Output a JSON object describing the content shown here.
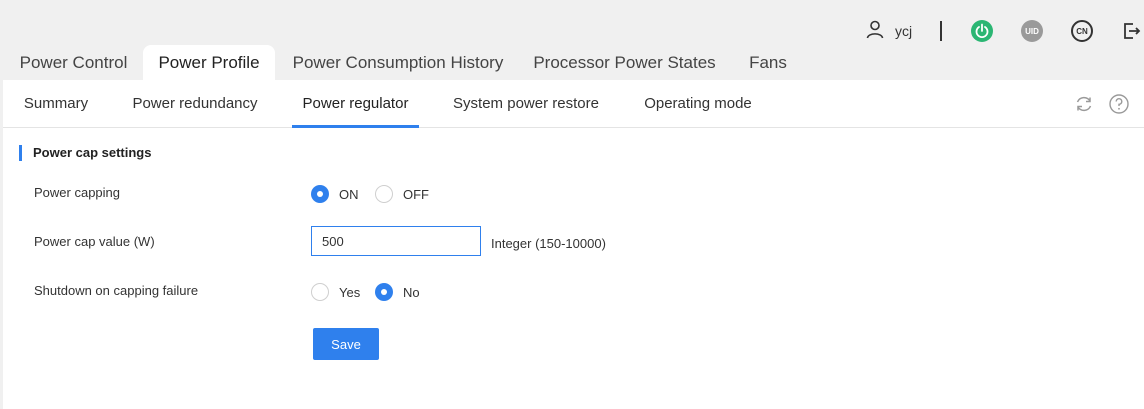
{
  "header": {
    "username": "ycj",
    "icons": {
      "user": "user-icon",
      "power": "power-icon",
      "uid": "UID",
      "language": "CN",
      "logout": "logout-icon"
    },
    "colors": {
      "power": "#2bb673",
      "uid": "#9a9a9a"
    }
  },
  "main_tabs": [
    {
      "label": "Power Control",
      "active": false
    },
    {
      "label": "Power Profile",
      "active": true
    },
    {
      "label": "Power Consumption History",
      "active": false
    },
    {
      "label": "Processor Power States",
      "active": false
    },
    {
      "label": "Fans",
      "active": false
    }
  ],
  "sub_tabs": [
    {
      "label": "Summary",
      "active": false
    },
    {
      "label": "Power redundancy",
      "active": false
    },
    {
      "label": "Power regulator",
      "active": true
    },
    {
      "label": "System power restore",
      "active": false
    },
    {
      "label": "Operating mode",
      "active": false
    }
  ],
  "section": {
    "title": "Power cap settings"
  },
  "form": {
    "power_capping": {
      "label": "Power capping",
      "options": [
        "ON",
        "OFF"
      ],
      "selected": "ON"
    },
    "power_cap_value": {
      "label": "Power cap value (W)",
      "value": "500",
      "hint": "Integer (150-10000)"
    },
    "shutdown_on_failure": {
      "label": "Shutdown on capping failure",
      "options": [
        "Yes",
        "No"
      ],
      "selected": "No"
    },
    "save_label": "Save"
  },
  "accent_color": "#2f80ed"
}
